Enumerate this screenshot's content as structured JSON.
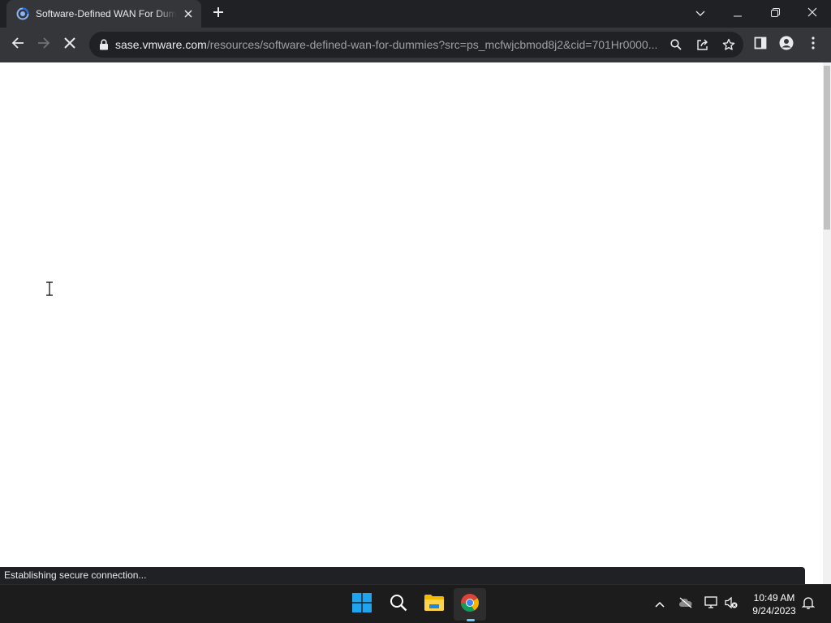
{
  "tab": {
    "title": "Software-Defined WAN For Dummies"
  },
  "icons": {
    "favicon": "vmware-sase-favicon-icon",
    "tab_close": "close-icon",
    "new_tab": "plus-icon",
    "tab_search": "chevron-down-icon",
    "minimize": "minimize-icon",
    "restore": "restore-icon",
    "close_window": "close-icon",
    "back": "arrow-left-icon",
    "forward": "arrow-right-icon",
    "stop": "stop-loading-icon",
    "lock": "lock-icon",
    "zoom": "search-icon",
    "share": "share-icon",
    "bookmark": "star-icon",
    "side_panel": "side-panel-icon",
    "profile": "profile-icon",
    "menu": "kebab-menu-icon"
  },
  "address_bar": {
    "host": "sase.vmware.com",
    "path": "/resources/software-defined-wan-for-dummies?src=ps_mcfwjcbmod8j2&cid=701Hr0000..."
  },
  "status": {
    "text": "Establishing secure connection..."
  },
  "scroll": {
    "thumb_fraction": 0.31,
    "position_fraction": 0.0
  },
  "taskbar": {
    "apps": [
      "start",
      "search",
      "file-explorer",
      "chrome"
    ],
    "active_app": "chrome",
    "time": "10:49 AM",
    "date": "9/24/2023"
  },
  "colors": {
    "tab_bg": "#35363a",
    "frame_bg": "#202124",
    "accent": "#60cdff"
  }
}
